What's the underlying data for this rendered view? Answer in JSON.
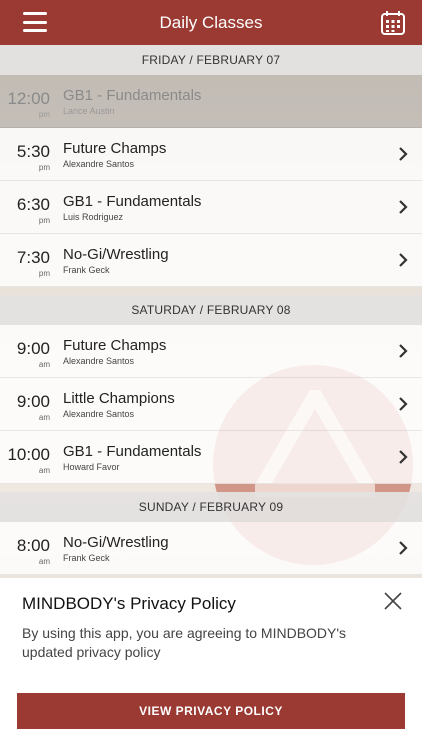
{
  "header": {
    "title": "Daily Classes"
  },
  "days": [
    {
      "date": "FRIDAY / FEBRUARY 07",
      "classes": [
        {
          "time": "12:00",
          "ampm": "pm",
          "name": "GB1 - Fundamentals",
          "instructor": "Lance Austin",
          "dimmed": true
        },
        {
          "time": "5:30",
          "ampm": "pm",
          "name": "Future Champs",
          "instructor": "Alexandre Santos"
        },
        {
          "time": "6:30",
          "ampm": "pm",
          "name": "GB1 - Fundamentals",
          "instructor": "Luis Rodriguez"
        },
        {
          "time": "7:30",
          "ampm": "pm",
          "name": "No-Gi/Wrestling",
          "instructor": "Frank Geck"
        }
      ]
    },
    {
      "date": "SATURDAY / FEBRUARY 08",
      "classes": [
        {
          "time": "9:00",
          "ampm": "am",
          "name": "Future Champs",
          "instructor": "Alexandre Santos"
        },
        {
          "time": "9:00",
          "ampm": "am",
          "name": "Little Champions",
          "instructor": "Alexandre Santos"
        },
        {
          "time": "10:00",
          "ampm": "am",
          "name": "GB1 - Fundamentals",
          "instructor": "Howard Favor"
        }
      ]
    },
    {
      "date": "SUNDAY / FEBRUARY 09",
      "classes": [
        {
          "time": "8:00",
          "ampm": "am",
          "name": "No-Gi/Wrestling",
          "instructor": "Frank Geck"
        }
      ]
    }
  ],
  "privacy": {
    "title": "MINDBODY's Privacy Policy",
    "body": "By using this app, you are agreeing to MINDBODY's updated privacy policy",
    "button": "VIEW PRIVACY POLICY"
  },
  "colors": {
    "brand": "#9a3a33"
  },
  "icons": {
    "menu": "hamburger-menu-icon",
    "calendar": "calendar-icon",
    "close": "close-icon",
    "chevron": "chevron-right-icon"
  }
}
